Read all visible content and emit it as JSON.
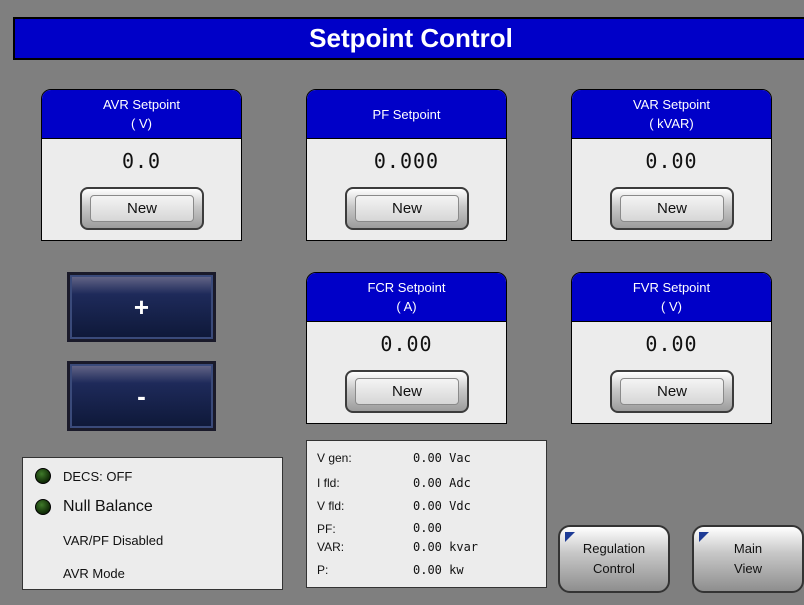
{
  "title": "Setpoint Control",
  "setpoints": [
    {
      "name": "AVR Setpoint",
      "unit": "( V)",
      "value": "0.0",
      "button": "New"
    },
    {
      "name": "PF Setpoint",
      "unit": "",
      "value": "0.000",
      "button": "New"
    },
    {
      "name": "VAR Setpoint",
      "unit": "( kVAR)",
      "value": "0.00",
      "button": "New"
    },
    {
      "name": "FCR Setpoint",
      "unit": "( A)",
      "value": "0.00",
      "button": "New"
    },
    {
      "name": "FVR Setpoint",
      "unit": "( V)",
      "value": "0.00",
      "button": "New"
    }
  ],
  "raise_label": "+",
  "lower_label": "-",
  "status": {
    "decs": "DECS: OFF",
    "null_balance": "Null Balance",
    "var_pf": "VAR/PF Disabled",
    "mode": "AVR Mode"
  },
  "meters": [
    {
      "label": "V gen:",
      "value": "0.00 Vac"
    },
    {
      "label": "I fld:",
      "value": "0.00 Adc"
    },
    {
      "label": "V fld:",
      "value": "0.00 Vdc"
    },
    {
      "label": "PF:",
      "value": "0.00"
    },
    {
      "label": "VAR:",
      "value": "0.00 kvar"
    },
    {
      "label": "P:",
      "value": "0.00 kw"
    }
  ],
  "nav": {
    "regulation_line1": "Regulation",
    "regulation_line2": "Control",
    "main_line1": "Main",
    "main_line2": "View"
  },
  "colors": {
    "header_blue": "#0000c8",
    "background": "#7f7f7f",
    "led_off": "#1f4a12"
  }
}
